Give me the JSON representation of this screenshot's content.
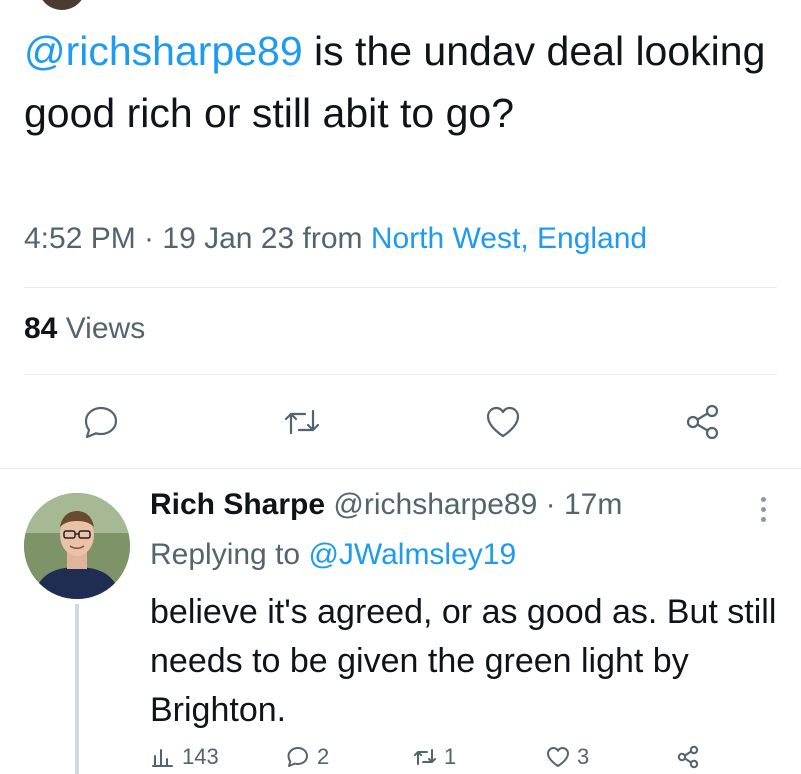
{
  "tweet": {
    "mention": "@richsharpe89",
    "text": " is the undav deal looking good rich or still abit to go?",
    "time": "4:52 PM · 19 Jan 23 from ",
    "location": "North West, England",
    "views_count": "84",
    "views_label": " Views",
    "action_icons": [
      "reply-icon",
      "retweet-icon",
      "like-icon",
      "share-icon"
    ]
  },
  "reply": {
    "name": "Rich Sharpe",
    "handle_time": " @richsharpe89 · 17m",
    "replying_prefix": "Replying to ",
    "replying_handle": "@JWalmsley19",
    "text": "believe it's agreed, or as good as. But still needs to be given the green light by Brighton.",
    "views": "143",
    "replies": "2",
    "retweets": "1",
    "likes": "3"
  },
  "colors": {
    "accent": "#1d9bf0",
    "text": "#0f1419",
    "secondary": "#536471",
    "divider": "#e6ecf0"
  }
}
